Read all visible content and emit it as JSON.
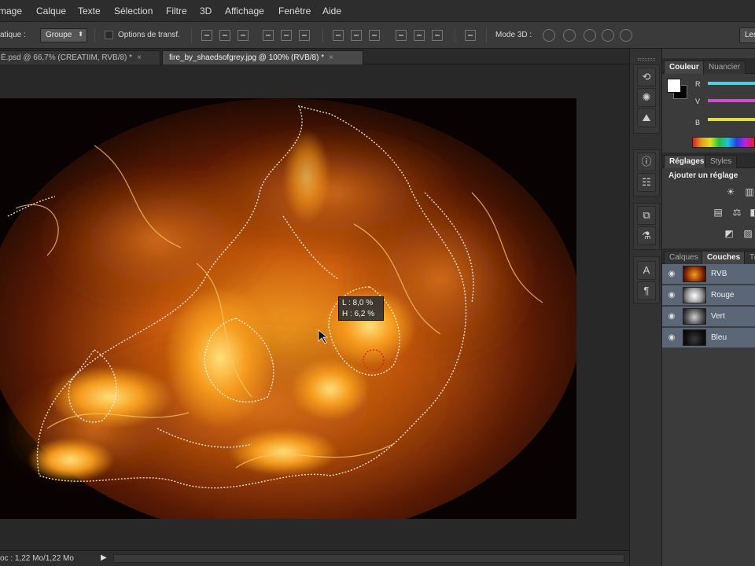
{
  "menu": [
    "mage",
    "Calque",
    "Texte",
    "Sélection",
    "Filtre",
    "3D",
    "Affichage",
    "Fenêtre",
    "Aide"
  ],
  "options": {
    "auto_select_label": "atique :",
    "group_select": "Groupe",
    "transform_label": "Options de transf.",
    "mode3d_label": "Mode 3D :",
    "right_button": "Les"
  },
  "tabs": [
    {
      "label": "È.psd @ 66,7% (CREATIIM, RVB/8) *",
      "close": "×"
    },
    {
      "label": "fire_by_shaedsofgrey.jpg @ 100% (RVB/8) *",
      "close": "×"
    }
  ],
  "tooltip": {
    "width": "L : 8,0 %",
    "height": "H : 6,2 %"
  },
  "status": {
    "doc": "oc : 1,22 Mo/1,22 Mo",
    "arrow": "▶"
  },
  "color_panel": {
    "tabs": [
      "Couleur",
      "Nuancier"
    ],
    "sliders": [
      {
        "label": "R",
        "color": "#4fd0e0"
      },
      {
        "label": "V",
        "color": "#d050c8"
      },
      {
        "label": "B",
        "color": "#e0e040"
      }
    ],
    "foreground": "#ffffff",
    "background": "#000000"
  },
  "adjust_panel": {
    "tabs": [
      "Réglages",
      "Styles"
    ],
    "title": "Ajouter un réglage"
  },
  "channels_panel": {
    "tabs": [
      "Calques",
      "Couches",
      "Tr"
    ],
    "channels": [
      {
        "name": "RVB"
      },
      {
        "name": "Rouge"
      },
      {
        "name": "Vert"
      },
      {
        "name": "Bleu"
      }
    ]
  },
  "dock_icons": [
    "history-icon",
    "brush-settings-icon",
    "navigator-icon",
    "info-icon",
    "properties-icon",
    "clone-source-icon",
    "actions-icon",
    "character-icon",
    "paragraph-icon"
  ],
  "dock_glyphs": [
    "⟲",
    "✺",
    "⛰",
    "ⓘ",
    "☷",
    "⧉",
    "⚗",
    "A",
    "¶"
  ]
}
